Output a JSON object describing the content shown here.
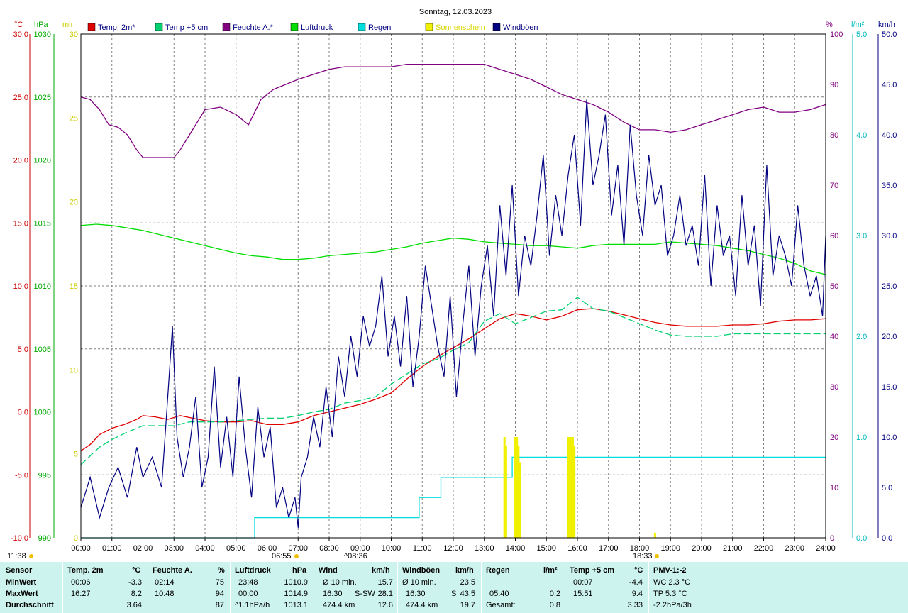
{
  "title": "Sonntag, 12.03.2023",
  "axis_units": {
    "temp": "°C",
    "pressure": "hPa",
    "minutes": "min",
    "humidity": "%",
    "rain": "l/m²",
    "wind": "km/h"
  },
  "colors": {
    "temp2m": "#e00000",
    "temp5cm": "#00d070",
    "humidity": "#800080",
    "pressure": "#00dd00",
    "rain": "#00dddd",
    "sunshine": "#f0f000",
    "gusts": "#000080",
    "grid": "#808080",
    "stats_bg": "#cdf3ee"
  },
  "legend": [
    {
      "label": "Temp. 2m*",
      "color": "#e00000"
    },
    {
      "label": "Temp +5 cm",
      "color": "#00d070"
    },
    {
      "label": "Feuchte A.*",
      "color": "#800080"
    },
    {
      "label": "Luftdruck",
      "color": "#00dd00"
    },
    {
      "label": "Regen",
      "color": "#00dddd"
    },
    {
      "label": "Sonnenschein",
      "color": "#f0f000"
    },
    {
      "label": "Windböen",
      "color": "#000080"
    }
  ],
  "markers": {
    "sunrise_label": "06:55",
    "sunset_label": "18:33",
    "noon_label": "^08:36",
    "start_label": "11:38"
  },
  "chart_data": {
    "type": "line",
    "x_label_ticks": [
      "00:00",
      "01:00",
      "02:00",
      "03:00",
      "04:00",
      "05:00",
      "06:00",
      "07:00",
      "08:00",
      "09:00",
      "10:00",
      "11:00",
      "12:00",
      "13:00",
      "14:00",
      "15:00",
      "16:00",
      "17:00",
      "18:00",
      "19:00",
      "20:00",
      "21:00",
      "22:00",
      "23:00",
      "24:00"
    ],
    "xlim": [
      0,
      24
    ],
    "axes": {
      "temp": {
        "lim": [
          -10,
          30
        ],
        "ticks": [
          "-10.0",
          "-5.0",
          "0.0",
          "5.0",
          "10.0",
          "15.0",
          "20.0",
          "25.0",
          "30.0"
        ]
      },
      "pressure": {
        "lim": [
          990,
          1030
        ],
        "ticks": [
          "990",
          "995",
          "1000",
          "1005",
          "1010",
          "1015",
          "1020",
          "1025",
          "1030"
        ]
      },
      "minutes": {
        "lim": [
          0,
          30
        ],
        "ticks": [
          "0",
          "5",
          "10",
          "15",
          "20",
          "25",
          "30"
        ]
      },
      "humidity": {
        "lim": [
          0,
          100
        ],
        "ticks": [
          "0",
          "10",
          "20",
          "30",
          "40",
          "50",
          "60",
          "70",
          "80",
          "90",
          "100"
        ]
      },
      "rain": {
        "lim": [
          0,
          5
        ],
        "ticks": [
          "0.0",
          "1.0",
          "2.0",
          "3.0",
          "4.0",
          "5.0"
        ]
      },
      "wind": {
        "lim": [
          0,
          50
        ],
        "ticks": [
          "0.0",
          "5.0",
          "10.0",
          "15.0",
          "20.0",
          "25.0",
          "30.0",
          "35.0",
          "40.0",
          "45.0",
          "50.0"
        ]
      }
    },
    "series": [
      {
        "name": "Temp. 2m*",
        "axis": "temp",
        "x": [
          0,
          0.3,
          0.6,
          1,
          1.4,
          1.8,
          2,
          2.4,
          2.8,
          3.2,
          3.6,
          4,
          4.5,
          5,
          5.5,
          6,
          6.5,
          7,
          7.5,
          8,
          8.5,
          9,
          9.5,
          10,
          10.5,
          11,
          11.5,
          12,
          12.5,
          13,
          13.5,
          14,
          14.5,
          15,
          15.5,
          16,
          16.5,
          17,
          17.5,
          18,
          18.5,
          19,
          19.5,
          20,
          20.5,
          21,
          21.5,
          22,
          22.5,
          23,
          23.5,
          24
        ],
        "y": [
          -3.1,
          -2.6,
          -1.8,
          -1.3,
          -1,
          -0.6,
          -0.3,
          -0.4,
          -0.6,
          -0.3,
          -0.5,
          -0.7,
          -0.8,
          -0.8,
          -0.7,
          -1,
          -1,
          -0.8,
          -0.3,
          0,
          0.3,
          0.6,
          1,
          1.5,
          2.6,
          3.6,
          4.4,
          5.1,
          5.8,
          6.6,
          7.4,
          7.8,
          7.6,
          7.3,
          7.6,
          8.1,
          8.2,
          8,
          7.7,
          7.4,
          7.1,
          6.9,
          6.8,
          6.8,
          6.8,
          6.9,
          6.9,
          7,
          7.2,
          7.3,
          7.3,
          7.4
        ]
      },
      {
        "name": "Temp +5 cm",
        "axis": "temp",
        "x": [
          0,
          0.3,
          0.6,
          1,
          1.5,
          2,
          2.5,
          3,
          3.5,
          4,
          4.5,
          5,
          5.5,
          6,
          6.5,
          7,
          7.5,
          8,
          8.5,
          9,
          9.5,
          10,
          10.5,
          11,
          11.5,
          12,
          12.5,
          13,
          13.5,
          14,
          14.5,
          15,
          15.5,
          16,
          16.5,
          17,
          17.5,
          18,
          18.5,
          19,
          19.5,
          20,
          20.5,
          21,
          21.5,
          22,
          22.5,
          23,
          23.5,
          24
        ],
        "y": [
          -4.2,
          -3.5,
          -2.8,
          -2.2,
          -1.6,
          -1.1,
          -1.1,
          -1.1,
          -0.8,
          -0.8,
          -0.8,
          -0.7,
          -0.6,
          -0.5,
          -0.5,
          -0.3,
          0,
          0.2,
          0.7,
          0.9,
          1.2,
          2.2,
          3,
          3.8,
          4.2,
          4.9,
          5.5,
          7.2,
          7.8,
          7,
          7.5,
          8,
          8.1,
          9.1,
          8.2,
          8,
          7.5,
          7,
          6.5,
          6.1,
          6,
          6,
          6,
          6.2,
          6.2,
          6.2,
          6.2,
          6.2,
          6.2,
          6.2
        ]
      },
      {
        "name": "Luftdruck",
        "axis": "pressure",
        "x": [
          0,
          0.5,
          1,
          1.5,
          2,
          2.5,
          3,
          3.5,
          4,
          4.5,
          5,
          5.5,
          6,
          6.5,
          7,
          7.5,
          8,
          8.5,
          9,
          9.5,
          10,
          10.5,
          11,
          11.5,
          12,
          12.5,
          13,
          13.5,
          14,
          14.5,
          15,
          15.5,
          16,
          16.5,
          17,
          17.5,
          18,
          18.5,
          19,
          19.5,
          20,
          20.5,
          21,
          21.5,
          22,
          22.5,
          23,
          23.5,
          24
        ],
        "y": [
          1014.8,
          1014.9,
          1014.8,
          1014.6,
          1014.4,
          1014.1,
          1013.8,
          1013.5,
          1013.2,
          1012.9,
          1012.6,
          1012.4,
          1012.3,
          1012.1,
          1012.1,
          1012.2,
          1012.4,
          1012.5,
          1012.6,
          1012.7,
          1012.9,
          1013.1,
          1013.4,
          1013.6,
          1013.8,
          1013.7,
          1013.5,
          1013.4,
          1013.3,
          1013.2,
          1013.2,
          1013.1,
          1013.0,
          1013.2,
          1013.3,
          1013.3,
          1013.3,
          1013.3,
          1013.5,
          1013.4,
          1013.3,
          1013.2,
          1013.0,
          1012.8,
          1012.5,
          1012.2,
          1011.8,
          1011.2,
          1010.9
        ]
      },
      {
        "name": "Feuchte A.*",
        "axis": "humidity",
        "x": [
          0,
          0.3,
          0.6,
          0.9,
          1.2,
          1.5,
          1.8,
          2,
          2.2,
          2.6,
          3,
          3.2,
          3.5,
          4,
          4.5,
          5,
          5.4,
          5.8,
          6.2,
          6.6,
          7,
          7.5,
          8,
          8.5,
          9,
          9.5,
          10,
          10.5,
          11,
          11.5,
          12,
          12.5,
          13,
          13.5,
          14,
          14.5,
          15,
          15.5,
          16,
          16.5,
          17,
          17.5,
          18,
          18.5,
          19,
          19.5,
          20,
          20.5,
          21,
          21.5,
          22,
          22.5,
          23,
          23.5,
          24
        ],
        "y": [
          87.5,
          87,
          85,
          82,
          81.5,
          80,
          77,
          75.5,
          75.5,
          75.5,
          75.5,
          77,
          80,
          85,
          85.5,
          84,
          82,
          87,
          89,
          90,
          91,
          92,
          93,
          93.5,
          93.5,
          93.5,
          93.5,
          94,
          94,
          94,
          94,
          94,
          94,
          93,
          92,
          91,
          89.5,
          88,
          87,
          86,
          84.5,
          82.5,
          81,
          81,
          80.5,
          81,
          82,
          83,
          84,
          85,
          85.5,
          84.5,
          84.5,
          85,
          86
        ]
      },
      {
        "name": "Regen",
        "axis": "rain",
        "x": [
          0,
          5.6,
          5.6,
          10.9,
          10.9,
          11.6,
          11.6,
          13.9,
          13.9,
          24
        ],
        "y": [
          0,
          0,
          0.2,
          0.2,
          0.4,
          0.4,
          0.6,
          0.6,
          0.8,
          0.8
        ]
      },
      {
        "name": "Sonnenschein",
        "axis": "minutes",
        "bars_x": [
          13.65,
          13.7,
          14,
          14.05,
          14.1,
          14.15,
          15.7,
          15.75,
          15.8,
          15.85,
          15.9,
          18.5
        ],
        "bars_y": [
          6,
          5.5,
          6,
          6,
          5.5,
          4.5,
          6,
          6,
          6,
          6,
          5.5,
          0.3
        ]
      },
      {
        "name": "Windböen",
        "axis": "wind",
        "x": [
          0,
          0.3,
          0.6,
          0.9,
          1.2,
          1.5,
          1.8,
          2,
          2.3,
          2.6,
          2.8,
          2.95,
          3.1,
          3.3,
          3.5,
          3.7,
          3.9,
          4.1,
          4.3,
          4.5,
          4.7,
          4.9,
          5.1,
          5.3,
          5.5,
          5.7,
          5.9,
          6.1,
          6.3,
          6.5,
          6.7,
          6.9,
          7,
          7.1,
          7.3,
          7.5,
          7.7,
          7.9,
          8.1,
          8.3,
          8.5,
          8.7,
          8.9,
          9.1,
          9.3,
          9.5,
          9.7,
          9.9,
          10.1,
          10.3,
          10.5,
          10.7,
          10.9,
          11.1,
          11.3,
          11.5,
          11.7,
          11.9,
          12.1,
          12.3,
          12.5,
          12.7,
          12.9,
          13.1,
          13.3,
          13.5,
          13.7,
          13.9,
          14.1,
          14.3,
          14.5,
          14.7,
          14.9,
          15.1,
          15.3,
          15.5,
          15.7,
          15.9,
          16.1,
          16.3,
          16.5,
          16.7,
          16.9,
          17.1,
          17.3,
          17.5,
          17.7,
          17.9,
          18.1,
          18.3,
          18.5,
          18.7,
          18.9,
          19.1,
          19.3,
          19.5,
          19.7,
          19.9,
          20.1,
          20.3,
          20.5,
          20.7,
          20.9,
          21.1,
          21.3,
          21.5,
          21.7,
          21.9,
          22.1,
          22.3,
          22.5,
          22.7,
          22.9,
          23.1,
          23.3,
          23.5,
          23.7,
          23.9,
          24
        ],
        "y": [
          3,
          6,
          2,
          5,
          7,
          4,
          9,
          6,
          8,
          5,
          14,
          21,
          10,
          6,
          9,
          14,
          5,
          8,
          17,
          7,
          12,
          6,
          16,
          9,
          4,
          13,
          8,
          11,
          3,
          5,
          2,
          4,
          1,
          6,
          8,
          12,
          9,
          15,
          10,
          18,
          14,
          20,
          16,
          22,
          19,
          21,
          26,
          18,
          22,
          17,
          24,
          15,
          20,
          27,
          23,
          19,
          16,
          24,
          14,
          21,
          27,
          18,
          25,
          29,
          22,
          33,
          26,
          35,
          24,
          30,
          27,
          32,
          38,
          28,
          34,
          30,
          36,
          40,
          31,
          43.5,
          35,
          38,
          42,
          32,
          37,
          29,
          41,
          34,
          30,
          38,
          33,
          35,
          28,
          30,
          34,
          29,
          31,
          27,
          36,
          25,
          33,
          28,
          30,
          24,
          34,
          27,
          31,
          23,
          37,
          26,
          30,
          28,
          25,
          33,
          27,
          24,
          26,
          22,
          30
        ]
      }
    ]
  },
  "stats": {
    "headers": {
      "sensor": "Sensor",
      "temp2m": "Temp. 2m",
      "temp2m_unit": "°C",
      "hum": "Feuchte A.",
      "hum_unit": "%",
      "press": "Luftdruck",
      "press_unit": "hPa",
      "wind": "Wind",
      "wind_unit": "km/h",
      "gust": "Windböen",
      "gust_unit": "km/h",
      "rain": "Regen",
      "rain_unit": "l/m²",
      "temp5": "Temp +5 cm",
      "temp5_unit": "°C",
      "pmv": "PMV-1:-2"
    },
    "rows": [
      {
        "label": "MinWert",
        "t2_time": "00:06",
        "t2_val": "-3.3",
        "h_time": "02:14",
        "h_val": "75",
        "p_time": "23:48",
        "p_val": "1010.9",
        "w_time": "Ø 10 min.",
        "w_val": "15.7",
        "g_time": "Ø 10 min.",
        "g_val": "23.5",
        "r_time": "",
        "r_val": "",
        "t5_time": "00:07",
        "t5_val": "-4.4",
        "pmv": "WC 2.3 °C"
      },
      {
        "label": "MaxWert",
        "t2_time": "16:27",
        "t2_val": "8.2",
        "h_time": "10:48",
        "h_val": "94",
        "p_time": "00:00",
        "p_val": "1014.9",
        "w_time": "16:30",
        "w_dir": "S-SW",
        "w_val": "28.1",
        "g_time": "16:30",
        "g_dir": "S",
        "g_val": "43.5",
        "r_time": "05:40",
        "r_val": "0.2",
        "t5_time": "15:51",
        "t5_val": "9.4",
        "pmv": "TP 5.3 °C"
      },
      {
        "label": "Durchschnitt",
        "t2_time": "",
        "t2_val": "3.64",
        "h_time": "",
        "h_val": "87",
        "p_time": "^1.1hPa/h",
        "p_val": "1013.1",
        "w_time": "474.4 km",
        "w_val": "12.6",
        "g_time": "474.4 km",
        "g_val": "19.7",
        "r_time": "Gesamt:",
        "r_val": "0.8",
        "t5_time": "",
        "t5_val": "3.33",
        "pmv": "-2.2hPa/3h"
      }
    ]
  }
}
